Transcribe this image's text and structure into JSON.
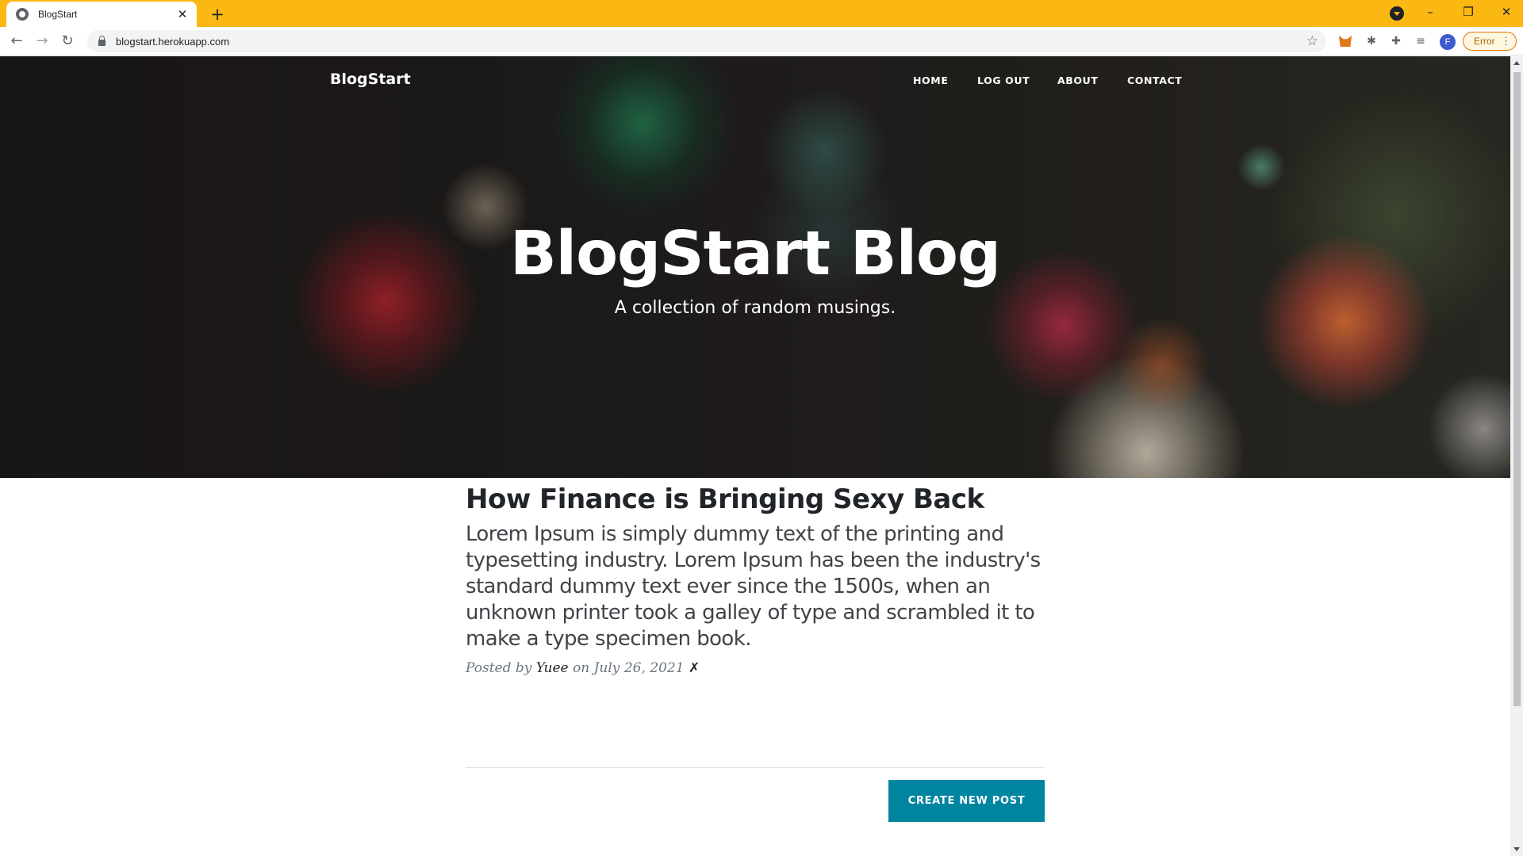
{
  "browser": {
    "tab_title": "BlogStart",
    "tab_close": "✕",
    "new_tab": "+",
    "url": "blogstart.herokuapp.com",
    "avatar_letter": "F",
    "error_label": "Error",
    "window_minimize": "–",
    "window_restore": "❐",
    "window_close": "✕"
  },
  "site": {
    "brand": "BlogStart",
    "nav": [
      {
        "label": "HOME"
      },
      {
        "label": "LOG OUT"
      },
      {
        "label": "ABOUT"
      },
      {
        "label": "CONTACT"
      }
    ],
    "hero": {
      "title": "BlogStart Blog",
      "subtitle": "A collection of random musings."
    }
  },
  "posts": [
    {
      "title": "How Finance is Bringing Sexy Back",
      "excerpt": "Lorem Ipsum is simply dummy text of the printing and typesetting industry. Lorem Ipsum has been the industry's standard dummy text ever since the 1500s, when an unknown printer took a galley of type and scrambled it to make a type specimen book.",
      "posted_by_prefix": "Posted by",
      "author": "Yuee",
      "date_prefix": "on",
      "date": "July 26, 2021",
      "delete_mark": "✗"
    }
  ],
  "actions": {
    "create_post": "CREATE NEW POST"
  },
  "colors": {
    "tabstrip": "#fbb813",
    "button": "#0085a1"
  }
}
